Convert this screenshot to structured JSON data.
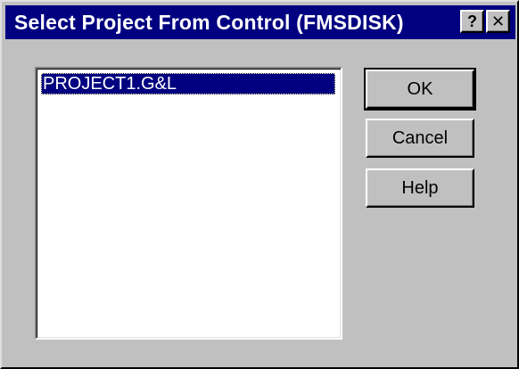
{
  "window": {
    "title": "Select Project From Control (FMSDISK)",
    "help_glyph": "?",
    "close_glyph": "✕"
  },
  "project_list": {
    "items": [
      "PROJECT1.G&L"
    ],
    "selected": "PROJECT1.G&L"
  },
  "buttons": {
    "ok": "OK",
    "cancel": "Cancel",
    "help": "Help"
  },
  "colors": {
    "titlebar": "#000080",
    "face": "#c0c0c0",
    "selection": "#000080"
  }
}
